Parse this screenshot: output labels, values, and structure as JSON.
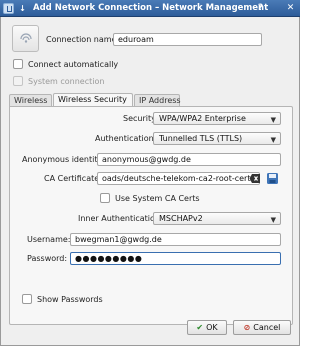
{
  "window": {
    "title": "Add Network Connection – Network Management"
  },
  "connection": {
    "name_label": "Connection name:",
    "name_value": "eduroam",
    "connect_auto_label": "Connect automatically",
    "system_connection_label": "System connection"
  },
  "tabs": [
    {
      "label": "Wireless"
    },
    {
      "label": "Wireless Security"
    },
    {
      "label": "IP Address"
    }
  ],
  "security": {
    "security_label": "Security:",
    "security_value": "WPA/WPA2 Enterprise",
    "auth_label": "Authentication:",
    "auth_value": "Tunnelled TLS (TTLS)",
    "anon_label": "Anonymous identity:",
    "anon_value": "anonymous@gwdg.de",
    "ca_label": "CA Certificate:",
    "ca_value": "oads/deutsche-telekom-ca2-root-cert.der",
    "use_system_ca_label": "Use System CA Certs",
    "inner_auth_label": "Inner Authentication:",
    "inner_auth_value": "MSCHAPv2",
    "username_label": "Username:",
    "username_value": "bwegman1@gwdg.de",
    "password_label": "Password:",
    "password_value": "●●●●●●●●●",
    "show_passwords_label": "Show Passwords"
  },
  "buttons": {
    "ok_label": "OK",
    "cancel_label": "Cancel"
  },
  "icons": {
    "network": "network-icon",
    "clear": "clear-field-icon",
    "open_file": "open-file-icon",
    "ok": "checkmark-icon",
    "cancel": "cancel-icon"
  },
  "colors": {
    "titlebar": "#2d5c99",
    "focus": "#3a6fb0"
  }
}
